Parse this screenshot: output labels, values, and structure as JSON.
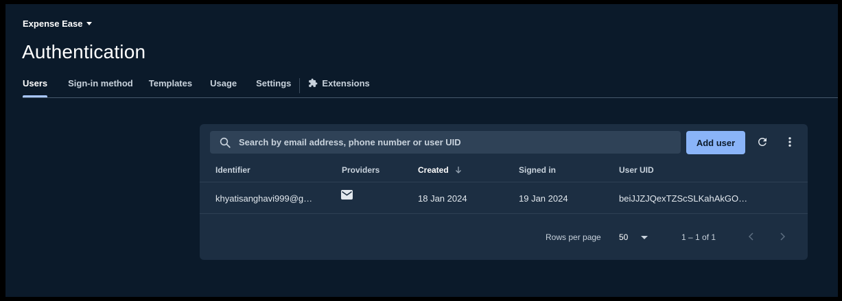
{
  "project": {
    "name": "Expense Ease",
    "caret_icon": "caret-down-icon"
  },
  "page": {
    "title": "Authentication"
  },
  "tabs": [
    {
      "label": "Users",
      "active": true
    },
    {
      "label": "Sign-in method",
      "active": false
    },
    {
      "label": "Templates",
      "active": false
    },
    {
      "label": "Usage",
      "active": false
    },
    {
      "label": "Settings",
      "active": false
    },
    {
      "label": "Extensions",
      "active": false,
      "icon": "extensions-icon"
    }
  ],
  "search": {
    "placeholder": "Search by email address, phone number or user UID",
    "value": "",
    "icon": "search-icon"
  },
  "actions": {
    "add_user_label": "Add user",
    "refresh_icon": "refresh-icon",
    "more_icon": "more-vert-icon"
  },
  "table": {
    "columns": [
      "Identifier",
      "Providers",
      "Created",
      "Signed in",
      "User UID"
    ],
    "sorted_column": "Created",
    "sort_direction": "descending",
    "rows": [
      {
        "identifier": "khyatisanghavi999@g…",
        "provider_icon": "mail-icon",
        "created": "18 Jan 2024",
        "signed_in": "19 Jan 2024",
        "uid": "beiJJZJQexTZScSLKahAkGO…"
      }
    ]
  },
  "pagination": {
    "rows_per_page_label": "Rows per page",
    "rows_per_page": "50",
    "range": "1 – 1 of 1"
  },
  "colors": {
    "background": "#0b1a2a",
    "card": "#1c2e42",
    "accent": "#8ab4f8",
    "search_bg": "#2f4257"
  }
}
